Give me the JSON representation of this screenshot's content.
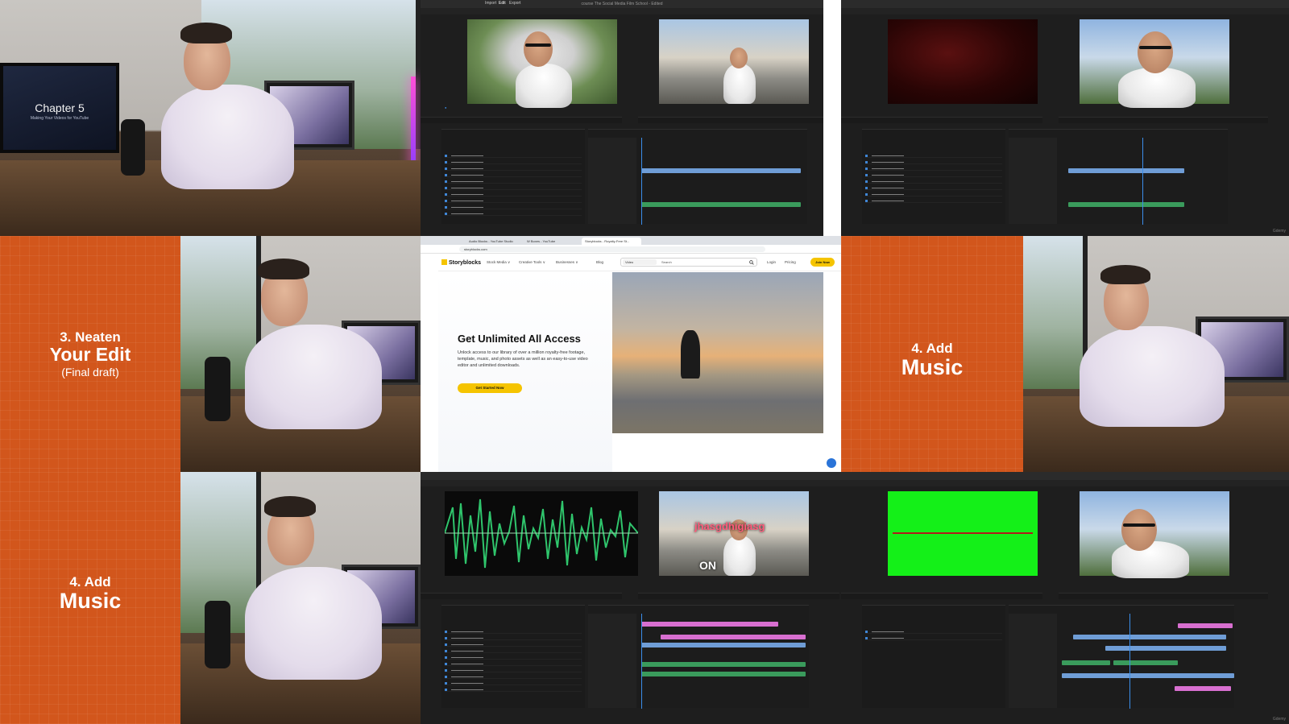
{
  "chapter_card": {
    "title": "Chapter 5",
    "subtitle": "Making Your Videos for YouTube"
  },
  "title_cards": {
    "neaten": {
      "line1": "3. Neaten",
      "line2": "Your Edit",
      "line3": "(Final draft)"
    },
    "music_right": {
      "line1": "4. Add",
      "line2": "Music"
    },
    "music_left": {
      "line1": "4. Add",
      "line2": "Music"
    }
  },
  "editor": {
    "workspaces": [
      "Import",
      "Edit",
      "Export"
    ],
    "window_title": "course The Social Media Film School - Edited",
    "overlay_text": "jhasgdhigiasg",
    "overlay_on": "ON",
    "watermark": "Gdemy"
  },
  "browser": {
    "tabs": [
      "Audio Blocks - YouTube Studio",
      "W Boxes - YouTube",
      "Storyblocks - Royalty-Free St..."
    ],
    "url": "storyblocks.com",
    "logo": "Storyblocks",
    "nav": [
      "Stock Media ∨",
      "Creative Tools ∨",
      "Businesses ∨",
      "Blog"
    ],
    "search_scope": "Video",
    "search_placeholder": "Search",
    "login": "Login",
    "pricing": "Pricing",
    "join": "Join Now",
    "hero_title": "Get Unlimited All Access",
    "hero_body": "Unlock access to our library of over a million royalty-free footage, template, music, and photo assets as well as an easy-to-use video editor and unlimited downloads.",
    "cta": "Get Started Now"
  },
  "colors": {
    "orange_card": "#d2561c",
    "storyblocks_yellow": "#f5c400",
    "premiere_blue": "#3b8eea",
    "green_screen": "#14f018"
  },
  "icons": [
    "mic-icon",
    "chat-icon",
    "search-icon",
    "chevron-down-icon"
  ]
}
